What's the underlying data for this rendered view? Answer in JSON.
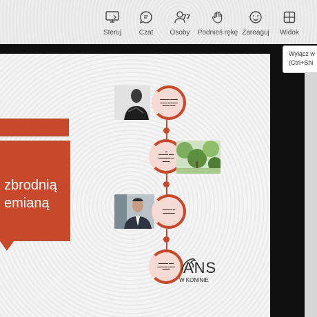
{
  "toolbar": {
    "items": [
      {
        "label": "Steruj",
        "icon": "share-screen-icon"
      },
      {
        "label": "Czat",
        "icon": "chat-icon"
      },
      {
        "label": "Osoby",
        "icon": "people-icon",
        "count": "77"
      },
      {
        "label": "Podnieś rękę",
        "icon": "raise-hand-icon"
      },
      {
        "label": "Zareaguj",
        "icon": "react-smiley-icon"
      },
      {
        "label": "Widok",
        "icon": "view-grid-icon"
      }
    ]
  },
  "tooltip": {
    "line1": "Wyłącz w",
    "line2": "(Ctrl+Shi"
  },
  "slide": {
    "title_line1": "zbrodnią",
    "title_line2": "emianą",
    "logo_text": "ANS",
    "logo_sub": "W KONINIE"
  },
  "colors": {
    "accent": "#c8482b",
    "node_fill": "#f4dad3"
  }
}
